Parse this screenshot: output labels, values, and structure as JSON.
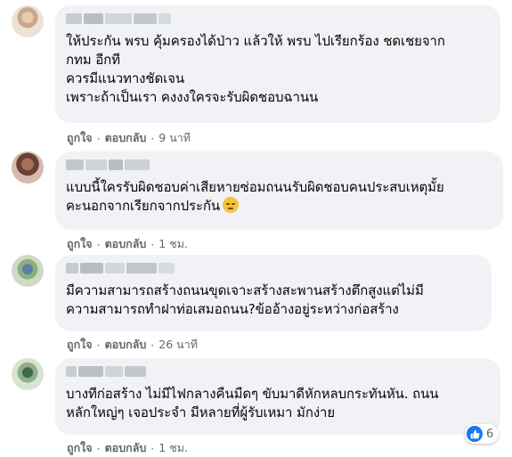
{
  "comments": [
    {
      "text": "ให้ประกัน พรบ คุ้มครองได้ป่าว แล้วให้ พรบ ไปเรียกร้อง ชดเชยจาก\nกทม อีกที\nควรมีแนวทางชัดเจน\nเพราะถ้าเป็นเรา คงงงใครจะรับผิดชอบฉานน",
      "like": "ถูกใจ",
      "reply": "ตอบกลับ",
      "time": "9 นาที"
    },
    {
      "text": "แบบนี้ใครรับผิดชอบค่าเสียหายซ่อมถนนรับผิดชอบคนประสบเหตุมั้ย\nคะนอกจากเรียกจากประกัน",
      "emoji": "downcast-face-emoji",
      "like": "ถูกใจ",
      "reply": "ตอบกลับ",
      "time": "1 ชม."
    },
    {
      "text": "มีความสามารถสร้างถนนขุดเจาะสร้างสะพานสร้างตึกสูงแต่ไม่มี\nความสามารถทำฝาท่อเสมอถนน?ข้ออ้างอยู่ระหว่างก่อสร้าง",
      "like": "ถูกใจ",
      "reply": "ตอบกลับ",
      "time": "26 นาที"
    },
    {
      "text": "บางทีก่อสร้าง ไม่มีไฟกลางคืนมืดๆ ขับมาดีหักหลบกระทันหัน. ถนน\nหลักใหญ่ๆ เจอประจำ มีหลายที่ผู้รับเหมา มักง่าย",
      "like": "ถูกใจ",
      "reply": "ตอบกลับ",
      "time": "1 ชม.",
      "reaction_count": "6"
    }
  ],
  "separator": "·",
  "colors": {
    "bubble": "#f0f2f5",
    "meta_text": "#65676b",
    "like_blue": "#1877f2"
  }
}
